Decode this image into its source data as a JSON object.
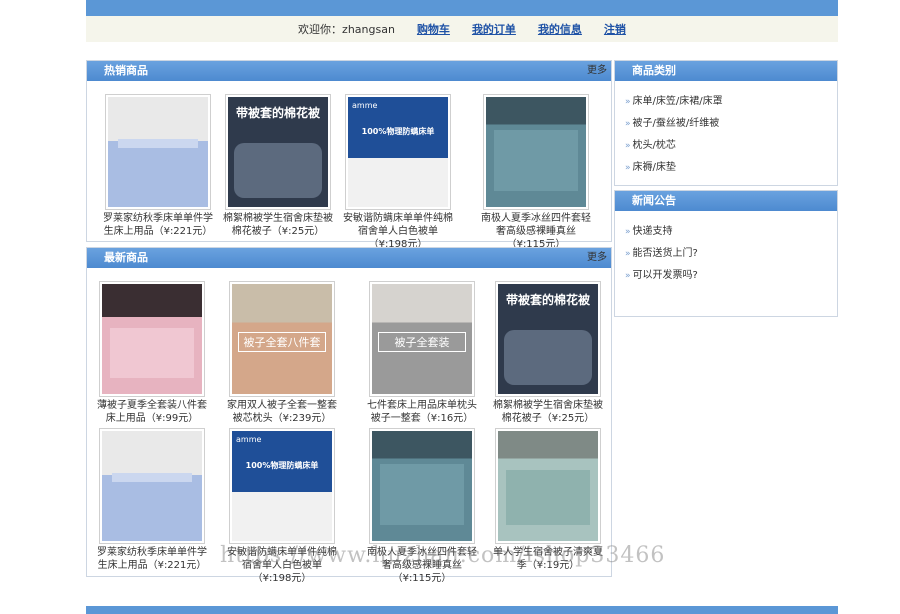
{
  "user_bar": {
    "welcome": "欢迎你：zhangsan",
    "links": [
      "购物车",
      "我的订单",
      "我的信息",
      "注销"
    ]
  },
  "hot": {
    "title": "热销商品",
    "more": "更多",
    "items": [
      {
        "name": "罗莱家纺秋季床单单件学生床上用品（¥:221元）"
      },
      {
        "name": "棉絮棉被学生宿舍床垫被棉花被子（¥:25元）"
      },
      {
        "name": "安敏谐防螨床单单件纯棉宿舍单人白色被单（¥:198元）"
      },
      {
        "name": "南极人夏季冰丝四件套轻奢高级感裸睡真丝（¥:115元）"
      }
    ]
  },
  "new": {
    "title": "最新商品",
    "more": "更多",
    "items": [
      {
        "name": "薄被子夏季全套装八件套床上用品（¥:99元）"
      },
      {
        "name": "家用双人被子全套一整套被芯枕头（¥:239元）"
      },
      {
        "name": "七件套床上用品床单枕头被子一整套（¥:16元）"
      },
      {
        "name": "棉絮棉被学生宿舍床垫被棉花被子（¥:25元）"
      },
      {
        "name": "罗莱家纺秋季床单单件学生床上用品（¥:221元）"
      },
      {
        "name": "安敏谐防螨床单单件纯棉宿舍单人白色被单（¥:198元）"
      },
      {
        "name": "南极人夏季冰丝四件套轻奢高级感裸睡真丝（¥:115元）"
      },
      {
        "name": "单人学生宿舍被子清爽夏季（¥:19元）"
      }
    ]
  },
  "category": {
    "title": "商品类别",
    "items": [
      "床单/床笠/床裙/床罩",
      "被子/蚕丝被/纤维被",
      "枕头/枕芯",
      "床褥/床垫"
    ]
  },
  "notice": {
    "title": "新闻公告",
    "items": [
      "快递支持",
      "能否送货上门?",
      "可以开发票吗?"
    ]
  },
  "image_text": {
    "quilt_caption": "带被套的棉花被",
    "amme_caption": "100%物理防螨床单",
    "amme_logo": "amme",
    "set8_caption": "被子全套八件套",
    "set_caption": "被子全套装"
  },
  "watermark": "https://www.huzhan.com/ishop33466"
}
